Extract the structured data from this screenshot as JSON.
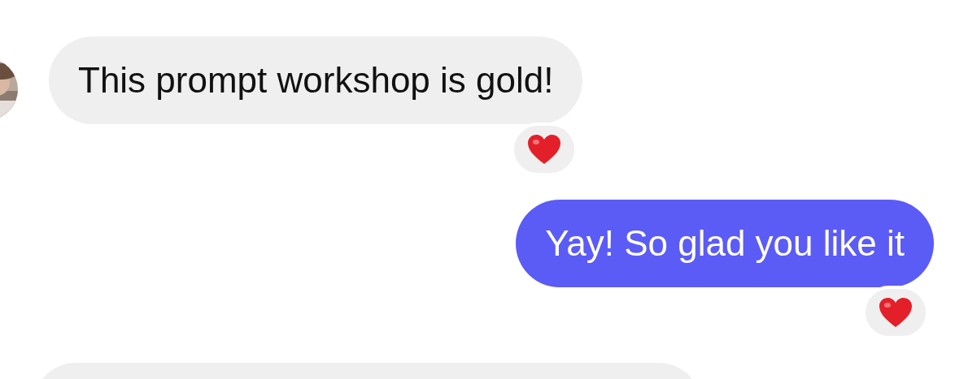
{
  "messages": [
    {
      "kind": "incoming",
      "avatar": true,
      "text": "This prompt workshop is gold!",
      "reaction": {
        "kind": "heart"
      }
    },
    {
      "kind": "outgoing",
      "text": "Yay! So glad you like it",
      "reaction": {
        "kind": "heart"
      }
    },
    {
      "kind": "incoming",
      "avatar": false
    }
  ]
}
